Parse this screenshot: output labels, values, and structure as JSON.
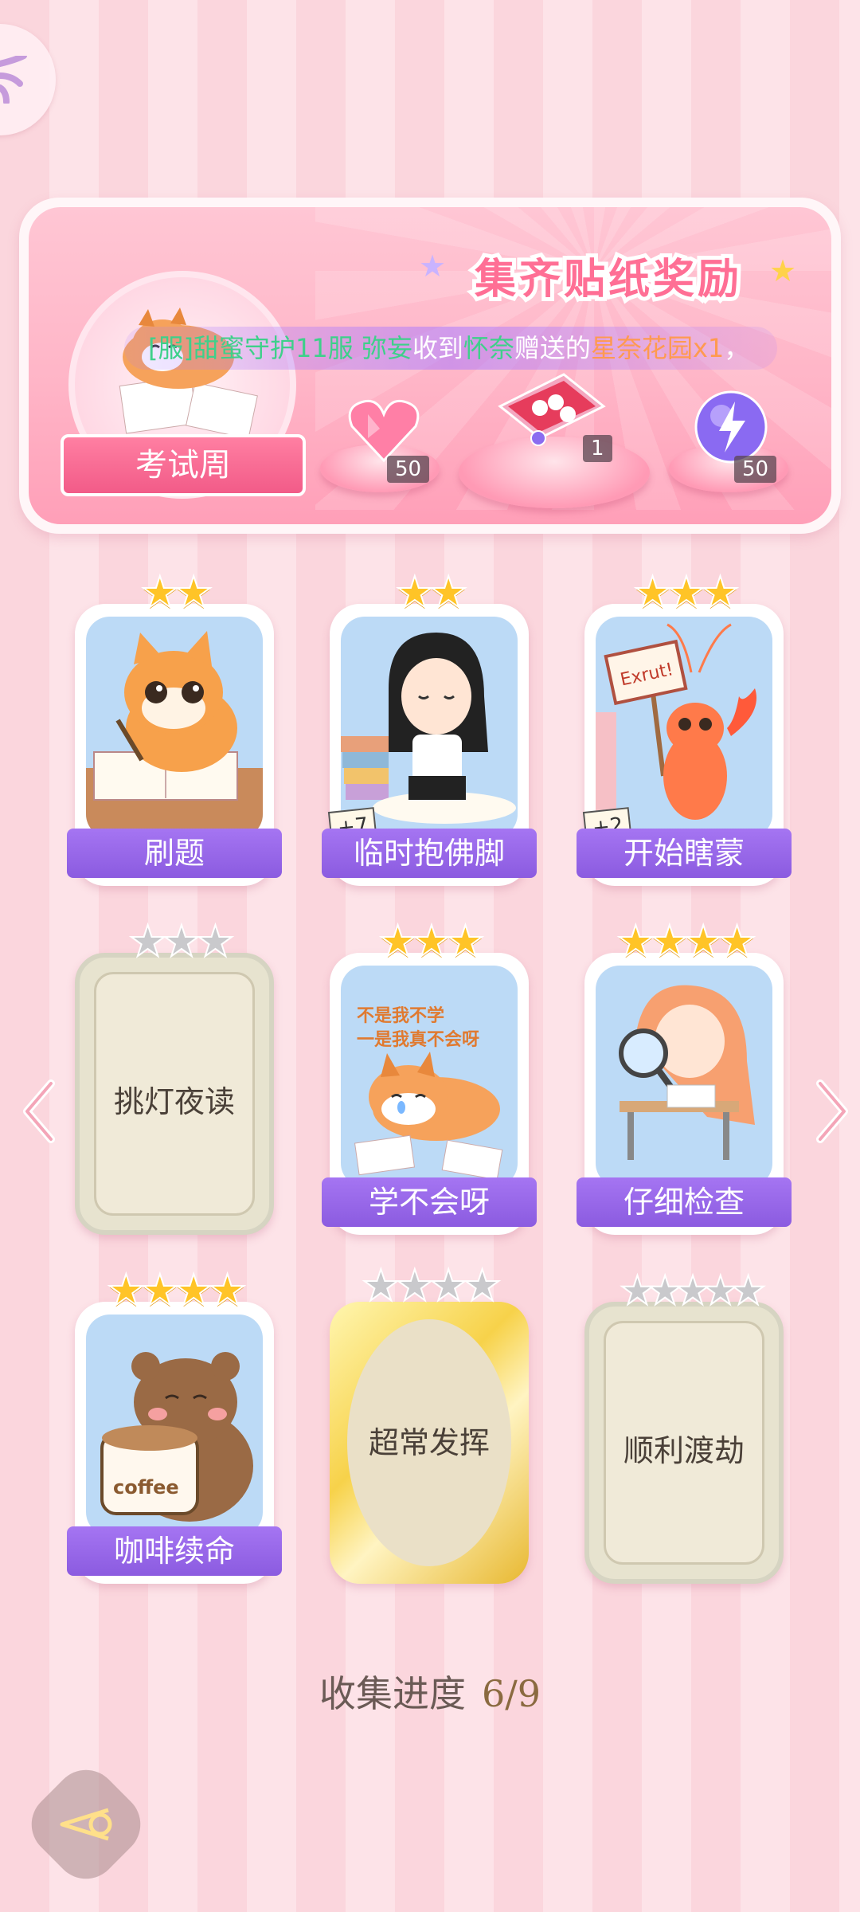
{
  "banner": {
    "title": "集齐贴纸奖励",
    "marquee": {
      "part1": "[服]甜蜜守护11服 ",
      "name1": "弥妄",
      "mid": "收到",
      "name2": "怀奈",
      "gift_verb": "赠送的",
      "gift": "星奈花园x1",
      "end": "，"
    },
    "album_name": "考试周",
    "rewards": [
      {
        "icon": "pink-heart-gem-icon",
        "count": "50"
      },
      {
        "icon": "gift-box-icon",
        "count": "1"
      },
      {
        "icon": "purple-lightning-orb-icon",
        "count": "50"
      }
    ]
  },
  "cards": [
    {
      "label": "刷题",
      "stars_on": 2,
      "stars_total": 2,
      "state": "collected",
      "extra": ""
    },
    {
      "label": "临时抱佛脚",
      "stars_on": 2,
      "stars_total": 2,
      "state": "collected",
      "extra": "+7"
    },
    {
      "label": "开始瞎蒙",
      "stars_on": 3,
      "stars_total": 3,
      "state": "collected",
      "extra": "+2",
      "sign_text": "Exrut!"
    },
    {
      "label": "挑灯夜读",
      "stars_on": 0,
      "stars_total": 3,
      "state": "locked",
      "extra": ""
    },
    {
      "label": "学不会呀",
      "stars_on": 3,
      "stars_total": 3,
      "state": "collected",
      "extra": "",
      "art_text_1": "不是我不学",
      "art_text_2": "一是我真不会呀"
    },
    {
      "label": "仔细检查",
      "stars_on": 4,
      "stars_total": 4,
      "state": "collected",
      "extra": ""
    },
    {
      "label": "咖啡续命",
      "stars_on": 4,
      "stars_total": 4,
      "state": "collected",
      "extra": "",
      "cup_text": "coffee"
    },
    {
      "label": "超常发挥",
      "stars_on": 0,
      "stars_total": 4,
      "state": "locked-gold",
      "extra": ""
    },
    {
      "label": "顺利渡劫",
      "stars_on": 0,
      "stars_total": 5,
      "state": "locked",
      "extra": ""
    }
  ],
  "progress": {
    "label": "收集进度",
    "value": "6/9"
  },
  "colors": {
    "label_purple": "#9466e8",
    "star_gold": "#ffc427",
    "star_gray": "#c9c9cc",
    "banner_pink": "#ffb5c7"
  }
}
